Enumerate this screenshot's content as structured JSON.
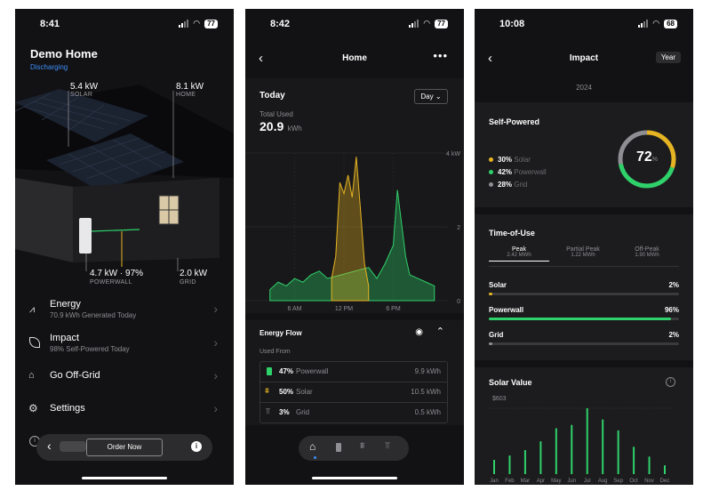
{
  "screen1": {
    "time": "8:41",
    "battery": "77",
    "site_name": "Demo Home",
    "status": "Discharging",
    "solar_value": "5.4 kW",
    "solar_label": "SOLAR",
    "home_value": "8.1 kW",
    "home_label": "HOME",
    "powerwall_value": "4.7 kW · 97%",
    "powerwall_label": "POWERWALL",
    "grid_value": "2.0 kW",
    "grid_label": "GRID",
    "menu": [
      {
        "title": "Energy",
        "subtitle": "70.9 kWh Generated Today",
        "icon": "energy-chart-icon"
      },
      {
        "title": "Impact",
        "subtitle": "98% Self-Powered Today",
        "icon": "leaf-icon"
      },
      {
        "title": "Go Off-Grid",
        "subtitle": "",
        "icon": "off-grid-house-icon"
      },
      {
        "title": "Settings",
        "subtitle": "",
        "icon": "gear-icon"
      }
    ],
    "order_now": "Order Now"
  },
  "screen2": {
    "time": "8:42",
    "battery": "77",
    "title": "Home",
    "period_title": "Today",
    "period_select": "Day",
    "total_label": "Total Used",
    "total_value": "20.9",
    "total_unit": "kWh",
    "y_ticks": [
      "4 kW",
      "2",
      "0"
    ],
    "x_ticks": [
      "6 AM",
      "12 PM",
      "6 PM"
    ],
    "energy_flow_title": "Energy Flow",
    "used_from_label": "Used From",
    "sources": [
      {
        "pct": "47%",
        "name": "Powerwall",
        "value": "9.9 kWh",
        "color": "#2fd16a"
      },
      {
        "pct": "50%",
        "name": "Solar",
        "value": "10.5 kWh",
        "color": "#e6b422"
      },
      {
        "pct": "3%",
        "name": "Grid",
        "value": "0.5 kWh",
        "color": "#8e8e93"
      }
    ]
  },
  "screen3": {
    "time": "10:08",
    "battery": "68",
    "title": "Impact",
    "period_button": "Year",
    "year": "2024",
    "self_powered_title": "Self-Powered",
    "gauge_value": "72",
    "gauge_unit": "%",
    "legend": [
      {
        "pct": "30%",
        "name": "Solar",
        "color": "#e6b422"
      },
      {
        "pct": "42%",
        "name": "Powerwall",
        "color": "#2fd16a"
      },
      {
        "pct": "28%",
        "name": "Grid",
        "color": "#8e8e93"
      }
    ],
    "tou_title": "Time-of-Use",
    "tou_tabs": [
      {
        "name": "Peak",
        "value": "2.42 MWh"
      },
      {
        "name": "Partial Peak",
        "value": "1.22 MWh"
      },
      {
        "name": "Off-Peak",
        "value": "1.90 MWh"
      }
    ],
    "tou_rows": [
      {
        "name": "Solar",
        "pct": "2%",
        "fraction": 0.02,
        "color": "#e6b422"
      },
      {
        "name": "Powerwall",
        "pct": "96%",
        "fraction": 0.96,
        "color": "#2fd16a"
      },
      {
        "name": "Grid",
        "pct": "2%",
        "fraction": 0.02,
        "color": "#8e8e93"
      }
    ],
    "solar_value_title": "Solar Value",
    "solar_value_max": "$603"
  },
  "chart_data": [
    {
      "type": "area",
      "title": "Today",
      "x_ticks": [
        "6 AM",
        "12 PM",
        "6 PM"
      ],
      "ylabel": "kW",
      "ylim": [
        0,
        4
      ],
      "series": [
        {
          "name": "Solar",
          "color": "#e6b422",
          "x_hours": [
            10.5,
            11,
            11.5,
            12,
            12.5,
            13,
            13.5,
            14,
            14.5,
            15
          ],
          "values": [
            0.6,
            1.2,
            3.2,
            2.9,
            3.4,
            2.8,
            3.9,
            2.5,
            1.0,
            0.4
          ]
        },
        {
          "name": "Powerwall",
          "color": "#2fd16a",
          "x_hours": [
            3,
            4,
            5,
            6,
            7,
            8,
            9,
            10,
            15,
            16,
            17,
            18,
            18.5,
            19,
            19.5,
            20,
            21,
            22,
            23
          ],
          "values": [
            0.3,
            0.5,
            0.4,
            0.6,
            0.5,
            0.7,
            0.8,
            0.6,
            0.9,
            0.6,
            1.0,
            1.5,
            3.0,
            2.1,
            1.2,
            0.7,
            0.6,
            0.5,
            0.4
          ]
        }
      ]
    },
    {
      "type": "bar",
      "title": "Solar Value",
      "categories": [
        "Jan",
        "Feb",
        "Mar",
        "Apr",
        "May",
        "Jun",
        "Jul",
        "Aug",
        "Sep",
        "Oct",
        "Nov",
        "Dec"
      ],
      "values": [
        130,
        170,
        220,
        300,
        420,
        450,
        603,
        500,
        400,
        250,
        160,
        80
      ],
      "ylim": [
        0,
        603
      ],
      "color": "#2fd16a"
    }
  ]
}
